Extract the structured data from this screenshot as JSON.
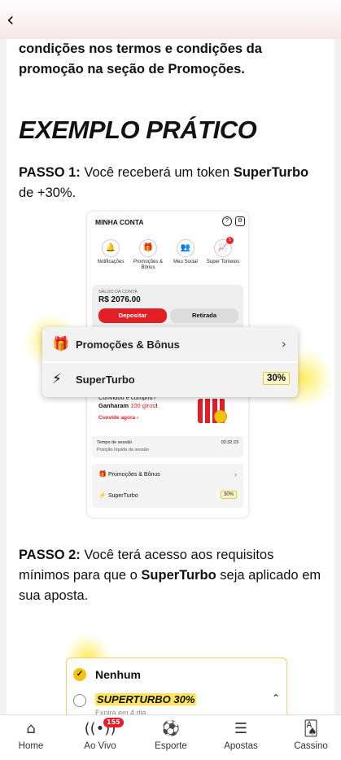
{
  "header": {
    "back_icon": "chevron-left-icon"
  },
  "intro_text": "condições nos termos e condições da promoção na seção de Promoções.",
  "heading": "EXEMPLO PRÁTICO",
  "step1": {
    "label": "PASSO 1:",
    "text_a": " Você receberá um token ",
    "highlight": "SuperTurbo",
    "text_b": " de +30%."
  },
  "phone": {
    "title": "MINHA CONTA",
    "icons": [
      "help-icon",
      "gear-icon"
    ],
    "quick_items": [
      {
        "label": "Notificações",
        "icon": "bell-icon"
      },
      {
        "label": "Promoções & Bônus",
        "icon": "gift-icon"
      },
      {
        "label": "Meu Social",
        "icon": "users-icon"
      },
      {
        "label": "Super Torneios",
        "icon": "chart-icon",
        "badge": "5"
      }
    ],
    "balance_label": "SALDO DA CONTA",
    "balance_value": "R$ 2076.00",
    "deposit": "Depositar",
    "withdraw": "Retirada",
    "invite_question": "Convidou e cumpriu?",
    "invite_won_a": "Ganharam ",
    "invite_won_b": "100 giros",
    "invite_won_c": "!",
    "invite_link": "Convide agora  ›",
    "session_label": "Tempo de sessão",
    "session_value": "03:32:23",
    "session_net": "Posição líquida da sessão",
    "list": [
      {
        "label": "Promoções & Bônus",
        "icon": "gift-icon"
      },
      {
        "label": "SuperTurbo",
        "icon": "lightning-icon",
        "value": "30%"
      }
    ]
  },
  "popup": {
    "rows": [
      {
        "label": "Promoções & Bônus",
        "icon": "gift-icon"
      },
      {
        "label": "SuperTurbo",
        "icon": "lightning-icon",
        "value": "30%"
      }
    ]
  },
  "step2": {
    "label": "PASSO 2:",
    "text_a": " Você terá acesso aos requisitos mínimos para que o ",
    "highlight": "SuperTurbo",
    "text_b": " seja aplicado em sua aposta."
  },
  "selector": {
    "option1": "Nenhum",
    "option2": "SUPERTURBO 30%",
    "option2_sub": "Expira em 4 dia"
  },
  "nav": [
    {
      "label": "Home",
      "icon": "home-icon"
    },
    {
      "label": "Ao Vivo",
      "icon": "live-icon",
      "badge": "155"
    },
    {
      "label": "Esporte",
      "icon": "soccer-ball-icon"
    },
    {
      "label": "Apostas",
      "icon": "ticket-icon"
    },
    {
      "label": "Cassino",
      "icon": "cards-icon"
    }
  ],
  "colors": {
    "accent": "#e01f26",
    "highlight": "#ffe55c"
  }
}
